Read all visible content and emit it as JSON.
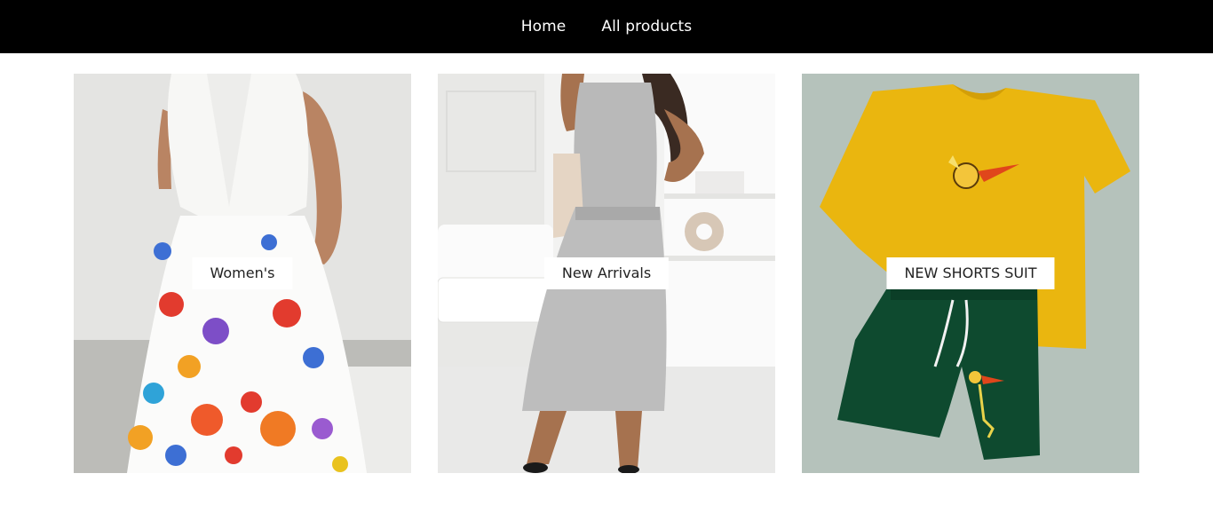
{
  "nav": {
    "items": [
      {
        "label": "Home"
      },
      {
        "label": "All products"
      }
    ]
  },
  "collections": [
    {
      "label": "Women's",
      "image": "white-floral-sleeveless-dress-photo"
    },
    {
      "label": "New Arrivals",
      "image": "gray-sleeveless-two-piece-dress-photo"
    },
    {
      "label": "NEW SHORTS SUIT",
      "image": "yellow-tshirt-green-shorts-set-photo"
    }
  ],
  "colors": {
    "header_bg": "#000000",
    "header_text": "#ffffff",
    "label_bg": "#ffffff",
    "label_text": "#222222"
  }
}
